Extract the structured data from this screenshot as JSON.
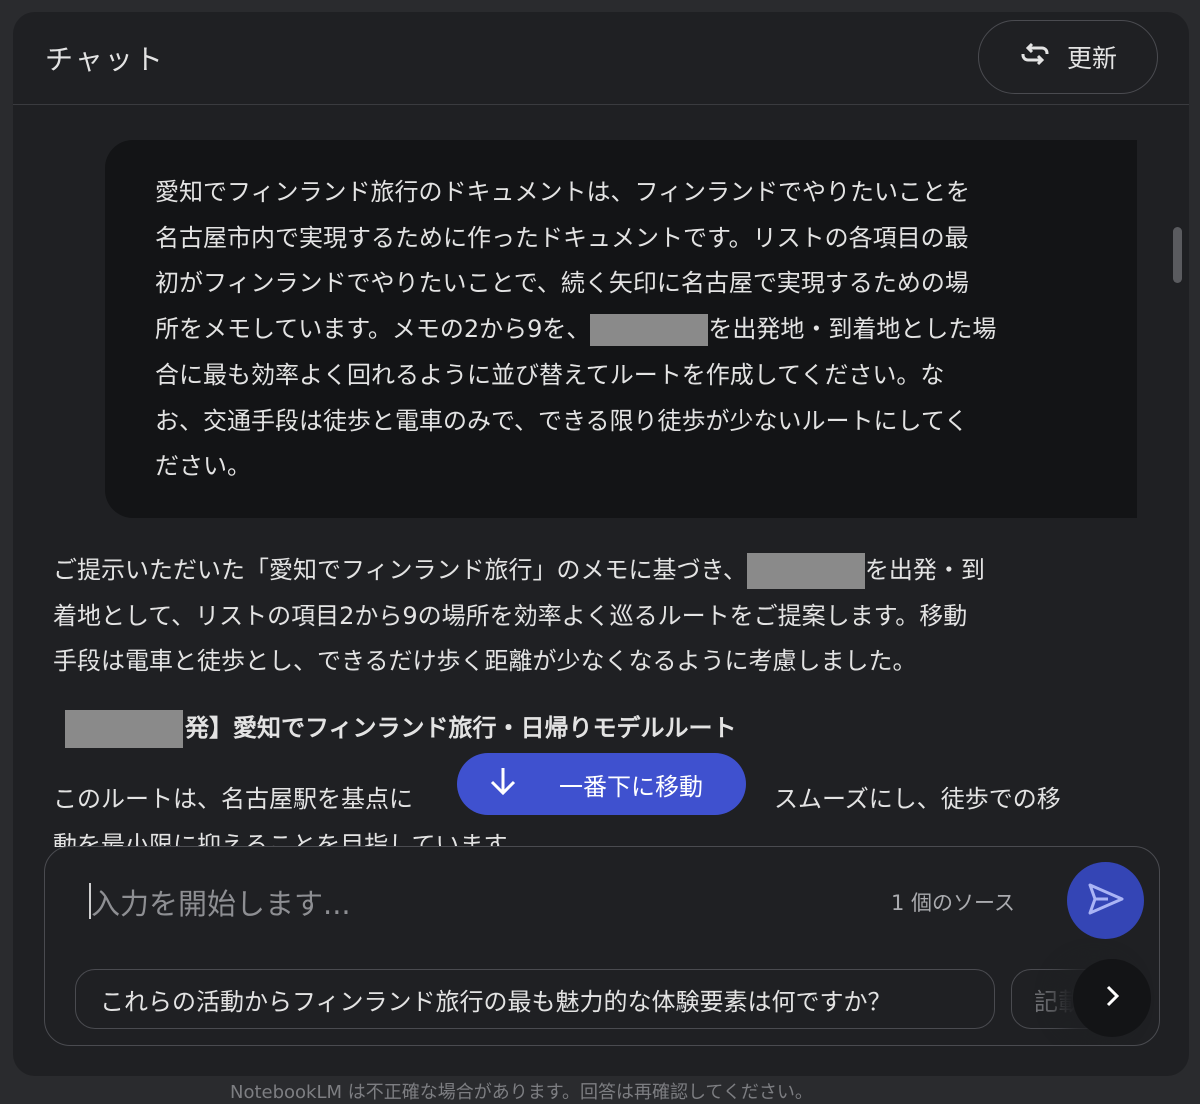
{
  "header": {
    "title": "チャット",
    "refresh_label": "更新"
  },
  "user_message": {
    "lines": [
      "愛知でフィンランド旅行のドキュメントは、フィンランドでやりたいことを",
      "名古屋市内で実現するために作ったドキュメントです。リストの各項目の最",
      "初がフィンランドでやりたいことで、続く矢印に名古屋で実現するための場"
    ],
    "line4_before": "所をメモしています。メモの2から9を、",
    "line4_after": "を出発地・到着地とした場",
    "lines_rest": [
      "合に最も効率よく回れるように並び替えてルートを作成してください。な",
      "お、交通手段は徒歩と電車のみで、できる限り徒歩が少ないルートにしてく",
      "ださい。"
    ]
  },
  "answer": {
    "line1_before": "ご提示いただいた「愛知でフィンランド旅行」のメモに基づき、",
    "line1_after": "を出発・到",
    "line2": "着地として、リストの項目2から9の場所を効率よく巡るルートをご提案します。移動",
    "line3": "手段は電車と徒歩とし、できるだけ歩く距離が少なくなるように考慮しました。"
  },
  "route_heading_after": "発】愛知でフィンランド旅行・日帰りモデルルート",
  "route_desc": {
    "line1_left": "このルートは、名古屋駅を基点に",
    "line1_right": "スムーズにし、徒歩での移",
    "line2": "動を最小限に抑えることを目指しています。"
  },
  "jump_button_label": "一番下に移動",
  "input": {
    "placeholder": "入力を開始します...",
    "source_count": "1 個のソース"
  },
  "suggestions": [
    "これらの活動からフィンランド旅行の最も魅力的な体験要素は何ですか？",
    "記載"
  ],
  "footer_text": "NotebookLM は不正確な場合があります。回答は再確認してください。",
  "colors": {
    "accent": "#3f51cf",
    "send": "#3445b5",
    "background": "#1f2023",
    "bubble": "#131416"
  }
}
